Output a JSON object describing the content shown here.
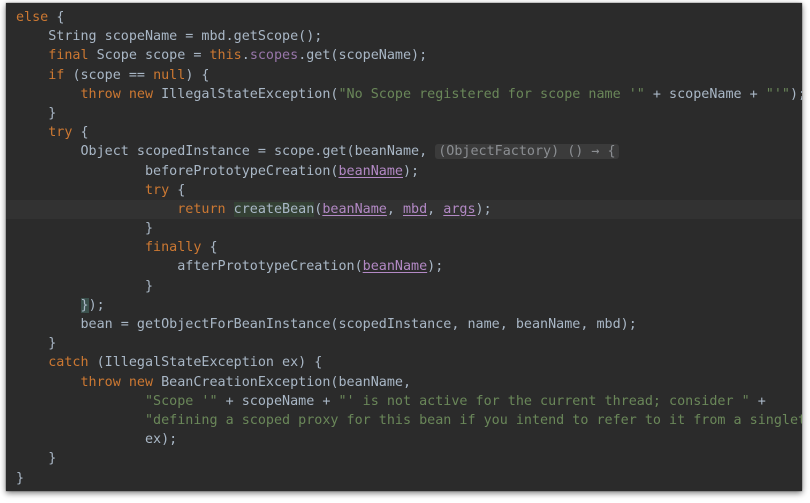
{
  "editor": {
    "theme_colors": {
      "background": "#2b2b2b",
      "keyword": "#cc7832",
      "string": "#6a8759",
      "field": "#9876aa",
      "parameter": "#b389c5",
      "text": "#a9b7c6",
      "hint": "#8b8e92"
    },
    "current_line": 11,
    "lines": [
      [
        [
          "kw",
          "else"
        ],
        [
          "",
          "{"
        ]
      ],
      [
        [
          "",
          "    String scopeName = mbd.getScope();"
        ]
      ],
      [
        [
          "kw",
          "    final "
        ],
        [
          "",
          "Scope scope = "
        ],
        [
          "kw",
          "this"
        ],
        [
          "",
          "."
        ],
        [
          "fld",
          "scopes"
        ],
        [
          "",
          ".get(scopeName);"
        ]
      ],
      [
        [
          "kw",
          "    if "
        ],
        [
          "",
          "(scope == "
        ],
        [
          "kw",
          "null"
        ],
        [
          "",
          ") {"
        ]
      ],
      [
        [
          "kw",
          "        throw new "
        ],
        [
          "",
          "IllegalStateException("
        ],
        [
          "str",
          "\"No Scope registered for scope name '\""
        ],
        [
          "",
          " + scopeName + "
        ],
        [
          "str",
          "\"'\""
        ],
        [
          "",
          ");"
        ]
      ],
      [
        [
          "",
          "    }"
        ]
      ],
      [
        [
          "kw",
          "    try "
        ],
        [
          "",
          "{"
        ]
      ],
      [
        [
          "",
          "        Object scopedInstance = scope.get(beanName, "
        ],
        [
          "hint",
          "(ObjectFactory) () → {"
        ]
      ],
      [
        [
          "",
          "                beforePrototypeCreation("
        ],
        [
          "prm",
          "beanName"
        ],
        [
          "",
          ");"
        ]
      ],
      [
        [
          "kw",
          "                try "
        ],
        [
          "",
          "{"
        ]
      ],
      [
        [
          "kw",
          "                    return "
        ],
        [
          "ref",
          "createBean"
        ],
        [
          "",
          "("
        ],
        [
          "prm",
          "beanName"
        ],
        [
          "",
          ", "
        ],
        [
          "prm",
          "mbd"
        ],
        [
          "",
          ", "
        ],
        [
          "prm",
          "args"
        ],
        [
          "",
          ");"
        ]
      ],
      [
        [
          "",
          "                }"
        ]
      ],
      [
        [
          "kw",
          "                finally "
        ],
        [
          "",
          "{"
        ]
      ],
      [
        [
          "",
          "                    afterPrototypeCreation("
        ],
        [
          "prm",
          "beanName"
        ],
        [
          "",
          ");"
        ]
      ],
      [
        [
          "",
          "                }"
        ]
      ],
      [
        [
          "",
          "        "
        ],
        [
          "brace",
          "}"
        ],
        [
          "",
          ");"
        ]
      ],
      [
        [
          "",
          "        bean = getObjectForBeanInstance(scopedInstance, name, beanName, mbd);"
        ]
      ],
      [
        [
          "",
          "    }"
        ]
      ],
      [
        [
          "kw",
          "    catch "
        ],
        [
          "",
          "(IllegalStateException ex) {"
        ]
      ],
      [
        [
          "kw",
          "        throw new "
        ],
        [
          "",
          "BeanCreationException(beanName,"
        ]
      ],
      [
        [
          "",
          "                "
        ],
        [
          "str",
          "\"Scope '\""
        ],
        [
          "",
          " + scopeName + "
        ],
        [
          "str",
          "\"' is not active for the current thread; consider \""
        ],
        [
          "",
          " +"
        ]
      ],
      [
        [
          "",
          "                "
        ],
        [
          "str",
          "\"defining a scoped proxy for this bean if you intend to refer to it from a singleton\""
        ],
        [
          "",
          ","
        ]
      ],
      [
        [
          "",
          "                ex);"
        ]
      ],
      [
        [
          "",
          "    }"
        ]
      ],
      [
        [
          "",
          "}"
        ]
      ]
    ]
  }
}
